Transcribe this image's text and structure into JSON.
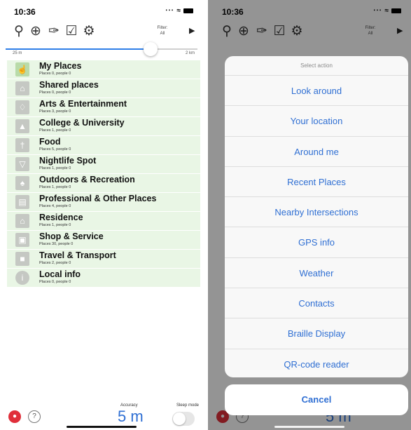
{
  "left": {
    "status": {
      "time": "10:36",
      "signal": "‥…"
    },
    "toolbar": {
      "filter_label": "Filter:",
      "filter_value": "All"
    },
    "slider": {
      "min_label": "25 m",
      "max_label": "2 km",
      "value_fraction": 0.74
    },
    "categories": [
      {
        "name": "My Places",
        "sub": "Places 0, people 0",
        "icon": "thumbs-up-icon"
      },
      {
        "name": "Shared places",
        "sub": "Places 0, people 0",
        "icon": "house-icon"
      },
      {
        "name": "Arts & Entertainment",
        "sub": "Places 3, people 0",
        "icon": "ticket-icon"
      },
      {
        "name": "College & University",
        "sub": "Places 1, people 0",
        "icon": "graduation-cap-icon"
      },
      {
        "name": "Food",
        "sub": "Places 5, people 0",
        "icon": "fork-knife-icon"
      },
      {
        "name": "Nightlife Spot",
        "sub": "Places 1, people 0",
        "icon": "cocktail-icon"
      },
      {
        "name": "Outdoors & Recreation",
        "sub": "Places 1, people 0",
        "icon": "tree-icon"
      },
      {
        "name": "Professional & Other Places",
        "sub": "Places 4, people 0",
        "icon": "building-icon"
      },
      {
        "name": "Residence",
        "sub": "Places 1, people 0",
        "icon": "home-icon"
      },
      {
        "name": "Shop & Service",
        "sub": "Places 30, people 0",
        "icon": "shopping-bag-icon"
      },
      {
        "name": "Travel & Transport",
        "sub": "Places 2, people 0",
        "icon": "suitcase-icon"
      },
      {
        "name": "Local info",
        "sub": "Places 0, people 0",
        "icon": "info-icon"
      }
    ],
    "bottom": {
      "accuracy_label": "Accuracy",
      "accuracy_value": "5 m",
      "sleep_label": "Sleep mode"
    }
  },
  "right": {
    "status": {
      "time": "10:36"
    },
    "sheet_title": "Select action",
    "actions": [
      "Look around",
      "Your location",
      "Around me",
      "Recent Places",
      "Nearby Intersections",
      "GPS info",
      "Weather",
      "Contacts",
      "Braille Display",
      "QR-code reader"
    ],
    "cancel": "Cancel",
    "accuracy_value": "5 m"
  },
  "colors": {
    "accent": "#2f6fd3",
    "row_bg": "#e9f6e5",
    "mic": "#e02f3a"
  }
}
